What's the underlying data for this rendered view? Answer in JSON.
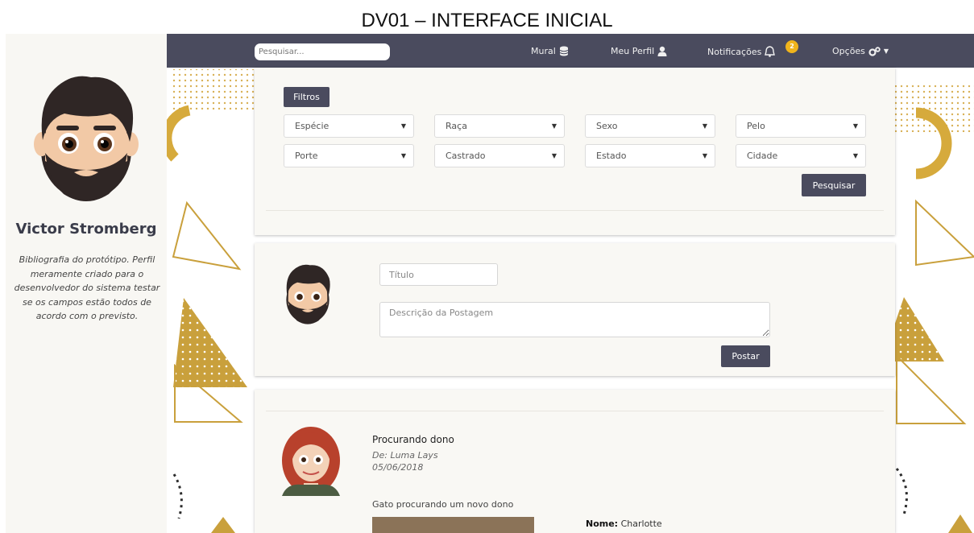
{
  "document_title": "DV01 – INTERFACE INICIAL",
  "navbar": {
    "search_placeholder": "Pesquisar...",
    "mural_label": "Mural",
    "profile_label": "Meu Perfil",
    "notifications_label": "Notificações",
    "notifications_count": "2",
    "options_label": "Opções"
  },
  "profile": {
    "name": "Victor Stromberg",
    "bio": "Bibliografia do protótipo. Perfil meramente criado para o desenvolvedor do sistema testar se os campos estão todos de acordo com o previsto."
  },
  "filters": {
    "button_label": "Filtros",
    "selects": [
      "Espécie",
      "Raça",
      "Sexo",
      "Pelo",
      "Porte",
      "Castrado",
      "Estado",
      "Cidade"
    ],
    "search_button": "Pesquisar"
  },
  "new_post": {
    "title_placeholder": "Título",
    "description_placeholder": "Descrição da Postagem",
    "submit_label": "Postar"
  },
  "feed": {
    "title": "Procurando dono",
    "author": "De: Luma Lays",
    "date": "05/06/2018",
    "text": "Gato procurando um novo dono",
    "name_label": "Nome:",
    "name_value": "Charlotte"
  },
  "colors": {
    "navbar": "#4a4b5e",
    "accent_gold": "#c9a03c",
    "card_bg": "#f9f8f4",
    "badge": "#f0b41c"
  }
}
